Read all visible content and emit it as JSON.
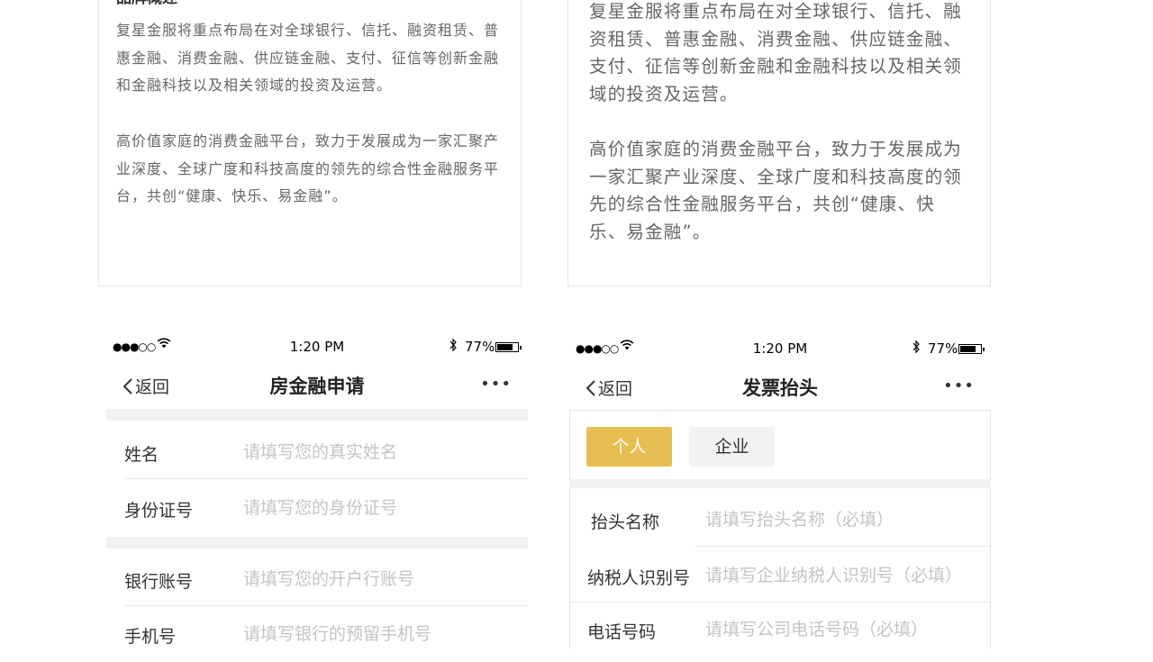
{
  "left_card": {
    "title": "品牌概述",
    "paragraph1": "复星金服将重点布局在对全球银行、信托、融资租赁、普惠金融、消费金融、供应链金融、支付、征信等创新金融和金融科技以及相关领域的投资及运营。",
    "paragraph2": "高价值家庭的消费金融平台，致力于发展成为一家汇聚产业深度、全球广度和科技高度的领先的综合性金融服务平台，共创“健康、快乐、易金融”。"
  },
  "right_card": {
    "paragraph1": "复星金服将重点布局在对全球银行、信托、融资租赁、普惠金融、消费金融、供应链金融、支付、征信等创新金融和金融科技以及相关领域的投资及运营。",
    "paragraph2": "高价值家庭的消费金融平台，致力于发展成为一家汇聚产业深度、全球广度和科技高度的领先的综合性金融服务平台，共创“健康、快乐、易金融”。"
  },
  "status_bar": {
    "signal": "●●●○○",
    "time": "1:20 PM",
    "battery": "77%",
    "battery_level": 0.77
  },
  "phone_left": {
    "back_label": "返回",
    "title": "房金融申请",
    "more": "•••",
    "fields": [
      {
        "label": "姓名",
        "placeholder": "请填写您的真实姓名"
      },
      {
        "label": "身份证号",
        "placeholder": "请填写您的身份证号"
      },
      {
        "label": "银行账号",
        "placeholder": "请填写您的开户行账号"
      },
      {
        "label": "手机号",
        "placeholder": "请填写银行的预留手机号"
      }
    ]
  },
  "phone_right": {
    "back_label": "返回",
    "title": "发票抬头",
    "more": "•••",
    "segments": [
      "个人",
      "企业"
    ],
    "fields": [
      {
        "label": "抬头名称",
        "placeholder": "请填写抬头名称（必填）"
      },
      {
        "label": "纳税人识别号",
        "placeholder": "请填写企业纳税人识别号（必填）"
      },
      {
        "label": "电话号码",
        "placeholder": "请填写公司电话号码（必填）"
      }
    ]
  },
  "colors": {
    "accent": "#e8be52",
    "section_gap": "#f2f2f2",
    "placeholder": "#c4c4c4"
  },
  "icons": [
    "chevron-left-icon",
    "wifi-icon",
    "bluetooth-icon",
    "battery-icon",
    "more-icon"
  ]
}
